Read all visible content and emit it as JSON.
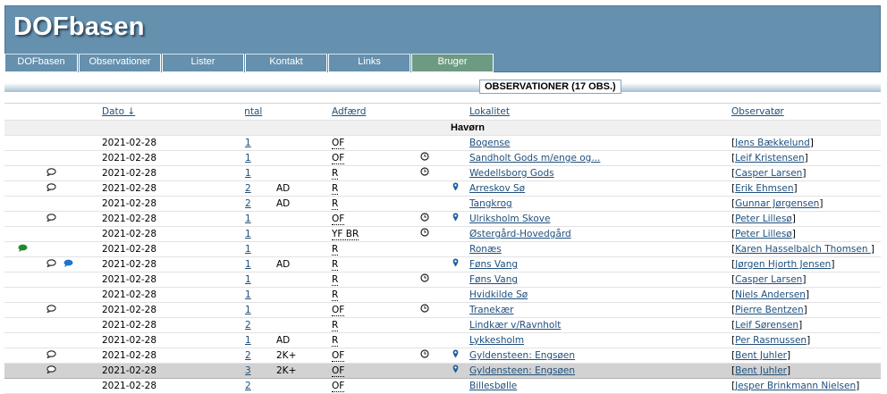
{
  "header": {
    "title": "DOFbasen"
  },
  "nav": [
    {
      "label": "DOFbasen",
      "active": false
    },
    {
      "label": "Observationer",
      "active": false
    },
    {
      "label": "Lister",
      "active": false
    },
    {
      "label": "Kontakt",
      "active": false
    },
    {
      "label": "Links",
      "active": false
    },
    {
      "label": "Bruger",
      "active": true
    }
  ],
  "caption": "OBSERVATIONER (17 OBS.)",
  "columns": {
    "dato": "Dato ↓",
    "antal": "Antal",
    "adfaerd": "Adfærd",
    "lokalitet": "Lokalitet",
    "observator": "Observatør"
  },
  "group_name": "Havørn",
  "rows": [
    {
      "green": false,
      "comment": false,
      "blue": false,
      "date": "2021-02-28",
      "count": "1",
      "age": "",
      "behavior": "OF",
      "clock": false,
      "pin": false,
      "location": "Bogense",
      "observer": "Jens Bækkelund",
      "highlight": false
    },
    {
      "green": false,
      "comment": false,
      "blue": false,
      "date": "2021-02-28",
      "count": "1",
      "age": "",
      "behavior": "OF",
      "clock": true,
      "pin": false,
      "location": "Sandholt Gods m/enge og...",
      "observer": "Leif Kristensen",
      "highlight": false
    },
    {
      "green": false,
      "comment": true,
      "blue": false,
      "date": "2021-02-28",
      "count": "1",
      "age": "",
      "behavior": "R",
      "clock": true,
      "pin": false,
      "location": "Wedellsborg Gods",
      "observer": "Casper Larsen",
      "highlight": false
    },
    {
      "green": false,
      "comment": true,
      "blue": false,
      "date": "2021-02-28",
      "count": "2",
      "age": "AD",
      "behavior": "R",
      "clock": false,
      "pin": true,
      "location": "Arreskov Sø",
      "observer": "Erik Ehmsen",
      "highlight": false
    },
    {
      "green": false,
      "comment": false,
      "blue": false,
      "date": "2021-02-28",
      "count": "2",
      "age": "AD",
      "behavior": "R",
      "clock": false,
      "pin": false,
      "location": "Tangkrog",
      "observer": "Gunnar Jørgensen",
      "highlight": false
    },
    {
      "green": false,
      "comment": true,
      "blue": false,
      "date": "2021-02-28",
      "count": "1",
      "age": "",
      "behavior": "OF",
      "clock": true,
      "pin": true,
      "location": "Ulriksholm Skove",
      "observer": "Peter Lillesø",
      "highlight": false
    },
    {
      "green": false,
      "comment": false,
      "blue": false,
      "date": "2021-02-28",
      "count": "1",
      "age": "",
      "behavior": "YF BR",
      "clock": true,
      "pin": false,
      "location": "Østergård-Hovedgård",
      "observer": "Peter Lillesø",
      "highlight": false
    },
    {
      "green": true,
      "comment": false,
      "blue": false,
      "date": "2021-02-28",
      "count": "1",
      "age": "",
      "behavior": "R",
      "clock": false,
      "pin": false,
      "location": "Ronæs",
      "observer": "Karen Hasselbalch Thomsen ",
      "highlight": false
    },
    {
      "green": false,
      "comment": true,
      "blue": true,
      "date": "2021-02-28",
      "count": "1",
      "age": "AD",
      "behavior": "R",
      "clock": false,
      "pin": true,
      "location": "Føns Vang",
      "observer": "Jørgen Hjorth Jensen",
      "highlight": false
    },
    {
      "green": false,
      "comment": false,
      "blue": false,
      "date": "2021-02-28",
      "count": "1",
      "age": "",
      "behavior": "R",
      "clock": true,
      "pin": false,
      "location": "Føns Vang",
      "observer": "Casper Larsen",
      "highlight": false
    },
    {
      "green": false,
      "comment": false,
      "blue": false,
      "date": "2021-02-28",
      "count": "1",
      "age": "",
      "behavior": "R",
      "clock": false,
      "pin": false,
      "location": "Hvidkilde Sø",
      "observer": "Niels Andersen",
      "highlight": false
    },
    {
      "green": false,
      "comment": true,
      "blue": false,
      "date": "2021-02-28",
      "count": "1",
      "age": "",
      "behavior": "OF",
      "clock": true,
      "pin": false,
      "location": "Tranekær",
      "observer": "Pierre Bentzen",
      "highlight": false
    },
    {
      "green": false,
      "comment": false,
      "blue": false,
      "date": "2021-02-28",
      "count": "2",
      "age": "",
      "behavior": "R",
      "clock": false,
      "pin": false,
      "location": "Lindkær v/Ravnholt",
      "observer": "Leif Sørensen",
      "highlight": false
    },
    {
      "green": false,
      "comment": false,
      "blue": false,
      "date": "2021-02-28",
      "count": "1",
      "age": "AD",
      "behavior": "R",
      "clock": false,
      "pin": false,
      "location": "Lykkesholm",
      "observer": "Per Rasmussen",
      "highlight": false
    },
    {
      "green": false,
      "comment": true,
      "blue": false,
      "date": "2021-02-28",
      "count": "2",
      "age": "2K+",
      "behavior": "OF",
      "clock": true,
      "pin": true,
      "location": "Gyldensteen: Engsøen",
      "observer": "Bent Juhler",
      "highlight": false
    },
    {
      "green": false,
      "comment": true,
      "blue": false,
      "date": "2021-02-28",
      "count": "3",
      "age": "2K+",
      "behavior": "OF",
      "clock": false,
      "pin": true,
      "location": "Gyldensteen: Engsøen",
      "observer": "Bent Juhler",
      "highlight": true
    },
    {
      "green": false,
      "comment": false,
      "blue": false,
      "date": "2021-02-28",
      "count": "2",
      "age": "",
      "behavior": "OF",
      "clock": false,
      "pin": false,
      "location": "Billesbølle",
      "observer": "Jesper Brinkmann Nielsen",
      "highlight": false
    }
  ]
}
